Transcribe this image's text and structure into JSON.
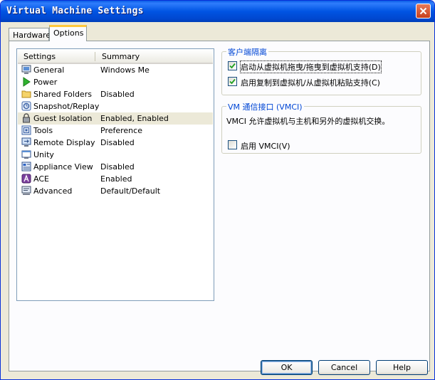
{
  "window": {
    "title": "Virtual Machine Settings"
  },
  "tabs": [
    {
      "label": "Hardware",
      "active": false
    },
    {
      "label": "Options",
      "active": true
    }
  ],
  "list": {
    "columns": [
      "Settings",
      "Summary"
    ],
    "rows": [
      {
        "name": "General",
        "summary": "Windows Me",
        "icon": "general-icon"
      },
      {
        "name": "Power",
        "summary": "",
        "icon": "power-icon"
      },
      {
        "name": "Shared Folders",
        "summary": "Disabled",
        "icon": "folder-icon"
      },
      {
        "name": "Snapshot/Replay",
        "summary": "",
        "icon": "snapshot-icon"
      },
      {
        "name": "Guest Isolation",
        "summary": "Enabled, Enabled",
        "icon": "lock-icon",
        "selected": true
      },
      {
        "name": "Tools",
        "summary": "Preference",
        "icon": "tools-icon"
      },
      {
        "name": "Remote Display",
        "summary": "Disabled",
        "icon": "remote-display-icon"
      },
      {
        "name": "Unity",
        "summary": "",
        "icon": "unity-icon"
      },
      {
        "name": "Appliance View",
        "summary": "Disabled",
        "icon": "appliance-icon"
      },
      {
        "name": "ACE",
        "summary": "Enabled",
        "icon": "ace-icon"
      },
      {
        "name": "Advanced",
        "summary": "Default/Default",
        "icon": "advanced-icon"
      }
    ]
  },
  "guest_isolation": {
    "title": "客户端隔离",
    "drag_drop": {
      "label": "启动从虚拟机拖曳/拖曳到虚拟机支持(D)",
      "checked": true
    },
    "copy_paste": {
      "label": "启用复制到虚拟机/从虚拟机粘贴支持(C)",
      "checked": true
    }
  },
  "vmci": {
    "title": "VM 通信接口 (VMCI)",
    "description": "VMCI 允许虚拟机与主机和另外的虚拟机交换。",
    "enable": {
      "label": "启用 VMCI(V)",
      "checked": false
    }
  },
  "buttons": {
    "ok": "OK",
    "cancel": "Cancel",
    "help": "Help"
  },
  "colors": {
    "titlebar": "#0054e3",
    "group_title": "#0046d5",
    "tab_highlight": "#ffc83c"
  }
}
